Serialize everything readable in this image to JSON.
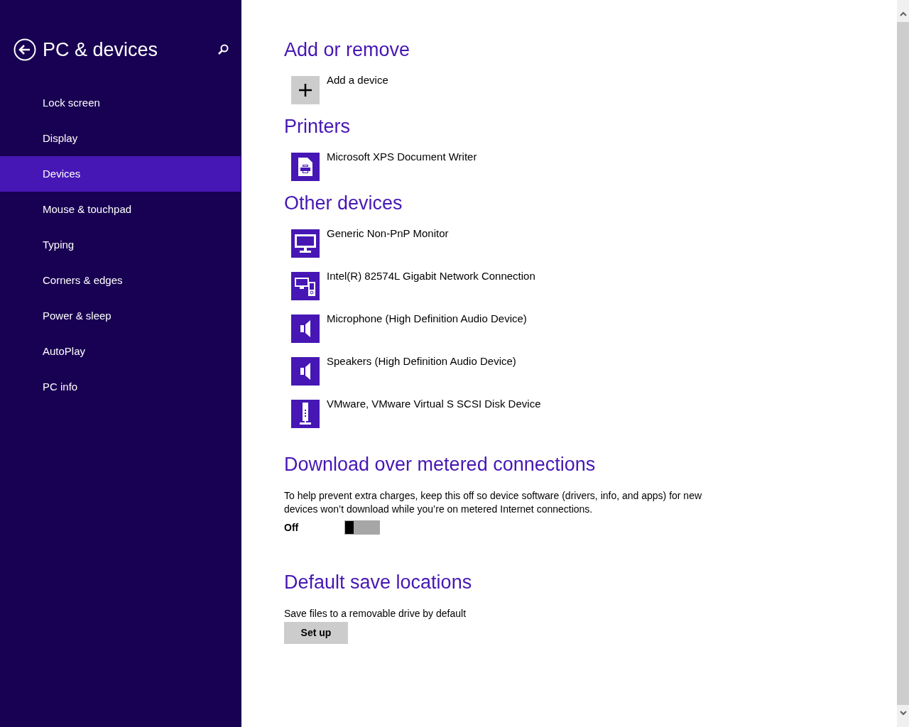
{
  "sidebar": {
    "title": "PC & devices",
    "items": [
      {
        "label": "Lock screen",
        "selected": false
      },
      {
        "label": "Display",
        "selected": false
      },
      {
        "label": "Devices",
        "selected": true
      },
      {
        "label": "Mouse & touchpad",
        "selected": false
      },
      {
        "label": "Typing",
        "selected": false
      },
      {
        "label": "Corners & edges",
        "selected": false
      },
      {
        "label": "Power & sleep",
        "selected": false
      },
      {
        "label": "AutoPlay",
        "selected": false
      },
      {
        "label": "PC info",
        "selected": false
      }
    ]
  },
  "sections": [
    {
      "heading": "Add or remove",
      "devices": [
        {
          "kind": "add",
          "label": "Add a device"
        }
      ]
    },
    {
      "heading": "Printers",
      "devices": [
        {
          "kind": "printer",
          "label": "Microsoft XPS Document Writer"
        }
      ]
    },
    {
      "heading": "Other devices",
      "devices": [
        {
          "kind": "monitor",
          "label": "Generic Non-PnP Monitor"
        },
        {
          "kind": "network",
          "label": "Intel(R) 82574L Gigabit Network Connection"
        },
        {
          "kind": "speaker",
          "label": "Microphone (High Definition Audio Device)"
        },
        {
          "kind": "speaker",
          "label": "Speakers (High Definition Audio Device)"
        },
        {
          "kind": "disk",
          "label": "VMware, VMware Virtual S SCSI Disk Device"
        }
      ]
    }
  ],
  "metered": {
    "heading": "Download over metered connections",
    "description": "To help prevent extra charges, keep this off so device software (drivers, info, and apps) for new devices won’t download while you’re on metered Internet connections.",
    "toggle": {
      "label": "Off",
      "on": false
    }
  },
  "save_locations": {
    "heading": "Default save locations",
    "description": "Save files to a removable drive by default",
    "button": "Set up"
  }
}
